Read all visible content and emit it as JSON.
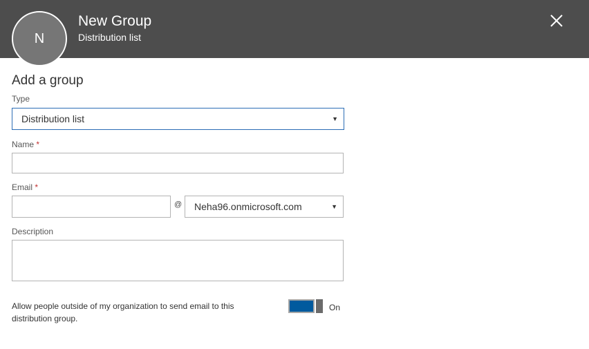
{
  "header": {
    "avatar_initial": "N",
    "title": "New Group",
    "subtitle": "Distribution list",
    "close_icon": "close-icon",
    "background_color": "#4d4d4d"
  },
  "form": {
    "section_title": "Add a group",
    "type": {
      "label": "Type",
      "selected_value": "Distribution list"
    },
    "name": {
      "label": "Name",
      "required_marker": "*",
      "value": ""
    },
    "email": {
      "label": "Email",
      "required_marker": "*",
      "value": "",
      "at_sign": "@",
      "domain_selected": "Neha96.onmicrosoft.com"
    },
    "description": {
      "label": "Description",
      "value": ""
    },
    "external_senders": {
      "text": "Allow people outside of my organization to send email to this distribution group.",
      "toggle_state": "On",
      "toggle_color": "#005a9e"
    }
  }
}
